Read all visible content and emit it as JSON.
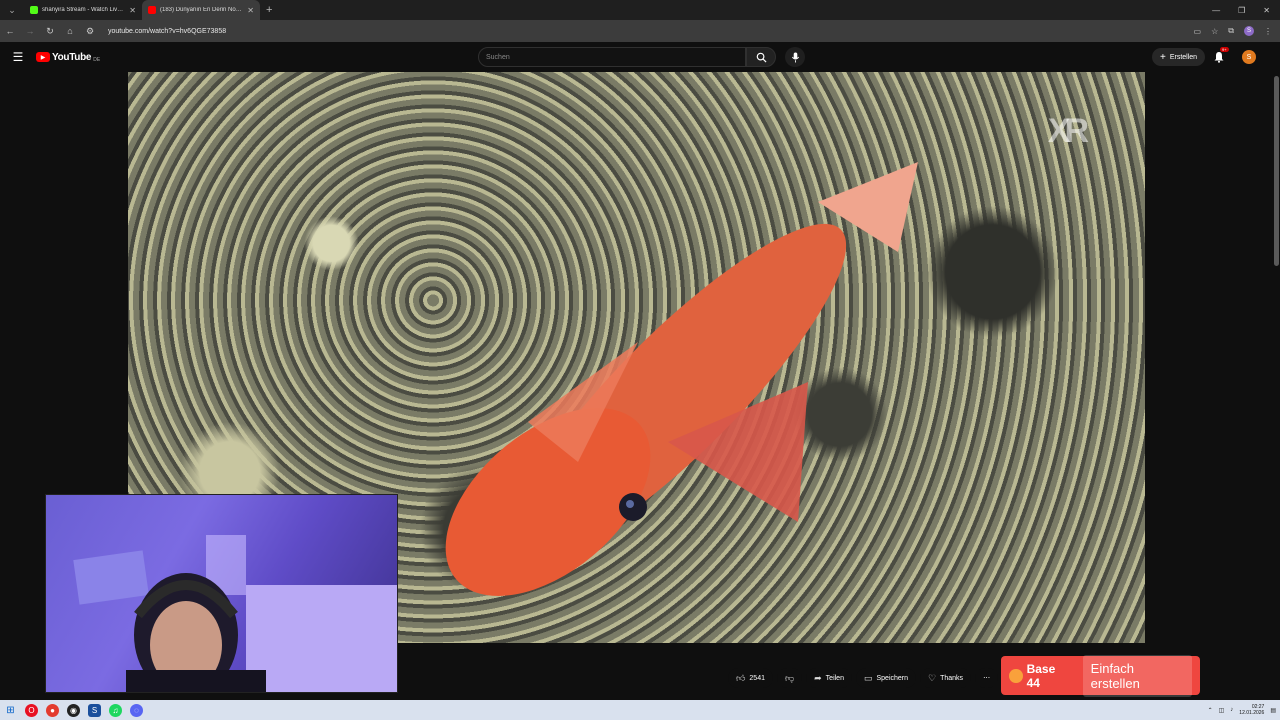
{
  "browser": {
    "tabs": [
      {
        "title": "shanyira Stream - Watch Live o",
        "favicon_color": "#53fc18",
        "active": false
      },
      {
        "title": "(183) Dünyanın En Derin Nokta",
        "favicon_color": "#ff0000",
        "active": true
      }
    ],
    "url": "youtube.com/watch?v=hv6QGE73858",
    "profile_initial": "S"
  },
  "youtube": {
    "logo_text": "YouTube",
    "country_code": "DE",
    "search_placeholder": "Suchen",
    "create_label": "Erstellen",
    "notification_badge": "9+",
    "avatar_initial": "S",
    "watermark": "XR"
  },
  "actions": {
    "like_count": "2541",
    "share_label": "Teilen",
    "save_label": "Speichern",
    "thanks_label": "Thanks",
    "more_label": "⋯"
  },
  "ad": {
    "brand": "Base 44",
    "cta": "Einfach erstellen"
  },
  "taskbar": {
    "time": "02:27",
    "date": "12.01.2026"
  },
  "colors": {
    "youtube_red": "#ff0000",
    "ad_bg": "#ef463f",
    "taskbar_bg": "#d9e1ee"
  }
}
